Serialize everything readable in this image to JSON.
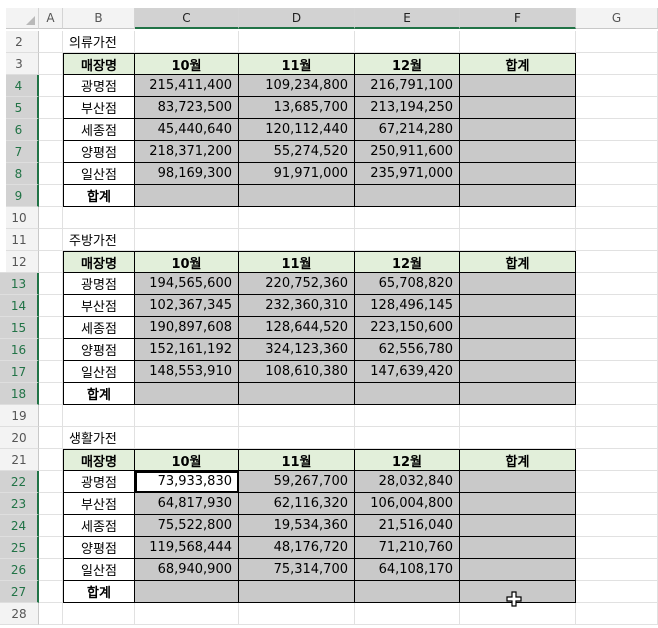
{
  "columns": [
    "A",
    "B",
    "C",
    "D",
    "E",
    "F",
    "G"
  ],
  "row_numbers": [
    "2",
    "3",
    "4",
    "5",
    "6",
    "7",
    "8",
    "9",
    "10",
    "11",
    "12",
    "13",
    "14",
    "15",
    "16",
    "17",
    "18",
    "19",
    "20",
    "21",
    "22",
    "23",
    "24",
    "25",
    "26",
    "27",
    "28"
  ],
  "tables": [
    {
      "title": "의류가전",
      "headers": [
        "매장명",
        "10월",
        "11월",
        "12월",
        "합계"
      ],
      "rows": [
        {
          "store": "광명점",
          "oct": "215,411,400",
          "nov": "109,234,800",
          "dec": "216,791,100"
        },
        {
          "store": "부산점",
          "oct": "83,723,500",
          "nov": "13,685,700",
          "dec": "213,194,250"
        },
        {
          "store": "세종점",
          "oct": "45,440,640",
          "nov": "120,112,440",
          "dec": "67,214,280"
        },
        {
          "store": "양평점",
          "oct": "218,371,200",
          "nov": "55,274,520",
          "dec": "250,911,600"
        },
        {
          "store": "일산점",
          "oct": "98,169,300",
          "nov": "91,971,000",
          "dec": "235,971,000"
        }
      ],
      "total_label": "합계"
    },
    {
      "title": "주방가전",
      "headers": [
        "매장명",
        "10월",
        "11월",
        "12월",
        "합계"
      ],
      "rows": [
        {
          "store": "광명점",
          "oct": "194,565,600",
          "nov": "220,752,360",
          "dec": "65,708,820"
        },
        {
          "store": "부산점",
          "oct": "102,367,345",
          "nov": "232,360,310",
          "dec": "128,496,145"
        },
        {
          "store": "세종점",
          "oct": "190,897,608",
          "nov": "128,644,520",
          "dec": "223,150,600"
        },
        {
          "store": "양평점",
          "oct": "152,161,192",
          "nov": "324,123,360",
          "dec": "62,556,780"
        },
        {
          "store": "일산점",
          "oct": "148,553,910",
          "nov": "108,610,380",
          "dec": "147,639,420"
        }
      ],
      "total_label": "합계"
    },
    {
      "title": "생활가전",
      "headers": [
        "매장명",
        "10월",
        "11월",
        "12월",
        "합계"
      ],
      "rows": [
        {
          "store": "광명점",
          "oct": "73,933,830",
          "nov": "59,267,700",
          "dec": "28,032,840"
        },
        {
          "store": "부산점",
          "oct": "64,817,930",
          "nov": "62,116,320",
          "dec": "106,004,800"
        },
        {
          "store": "세종점",
          "oct": "75,522,800",
          "nov": "19,534,360",
          "dec": "21,516,040"
        },
        {
          "store": "양평점",
          "oct": "119,568,444",
          "nov": "48,176,720",
          "dec": "71,210,760"
        },
        {
          "store": "일산점",
          "oct": "68,940,900",
          "nov": "75,314,700",
          "dec": "64,108,170"
        }
      ],
      "total_label": "합계"
    }
  ],
  "colors": {
    "header_fill": "#e2efda",
    "data_fill": "#c9c9c9",
    "selection_accent": "#217346"
  },
  "icons": {
    "cursor": "plus-cursor-icon"
  }
}
